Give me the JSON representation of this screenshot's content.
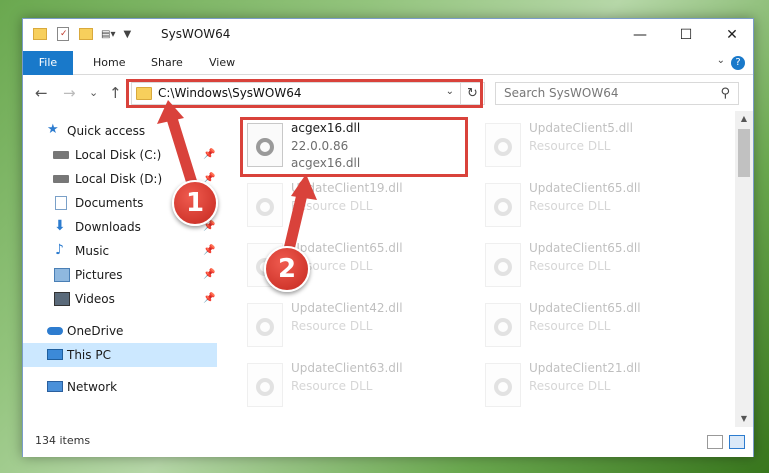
{
  "titlebar": {
    "title": "SysWOW64",
    "minimize": "—",
    "maximize": "☐",
    "close": "✕"
  },
  "ribbon": {
    "tabs": [
      {
        "label": "File"
      },
      {
        "label": "Home"
      },
      {
        "label": "Share"
      },
      {
        "label": "View"
      }
    ],
    "help": "?"
  },
  "nav": {
    "back": "←",
    "forward": "→",
    "recent": "⌄",
    "up": "↑",
    "address": "C:\\Windows\\SysWOW64",
    "refresh": "↻",
    "search_placeholder": "Search SysWOW64"
  },
  "sidebar": {
    "items": [
      {
        "label": "Quick access",
        "icon": "star-icon"
      },
      {
        "label": "Local Disk (C:)",
        "icon": "drive-icon",
        "pinned": true
      },
      {
        "label": "Local Disk (D:)",
        "icon": "drive-icon",
        "pinned": true
      },
      {
        "label": "Documents",
        "icon": "documents-icon",
        "pinned": true
      },
      {
        "label": "Downloads",
        "icon": "downloads-icon",
        "pinned": true
      },
      {
        "label": "Music",
        "icon": "music-icon",
        "pinned": true
      },
      {
        "label": "Pictures",
        "icon": "pictures-icon",
        "pinned": true
      },
      {
        "label": "Videos",
        "icon": "videos-icon",
        "pinned": true
      },
      {
        "label": "OneDrive",
        "icon": "onedrive-icon"
      },
      {
        "label": "This PC",
        "icon": "pc-icon",
        "selected": true
      },
      {
        "label": "Network",
        "icon": "network-icon"
      }
    ]
  },
  "files": [
    {
      "name": "acgex16.dll",
      "line2": "22.0.0.86",
      "line3": "acgex16.dll",
      "highlight": true
    },
    {
      "name": "UpdateClient5.dll",
      "line2": "Resource DLL"
    },
    {
      "name": "UpdateClient19.dll",
      "line2": "Resource DLL"
    },
    {
      "name": "UpdateClient65.dll",
      "line2": "Resource DLL"
    },
    {
      "name": "UpdateClient65.dll",
      "line2": "Resource DLL"
    },
    {
      "name": "UpdateClient65.dll",
      "line2": "Resource DLL"
    },
    {
      "name": "UpdateClient42.dll",
      "line2": "Resource DLL"
    },
    {
      "name": "UpdateClient65.dll",
      "line2": "Resource DLL"
    },
    {
      "name": "UpdateClient63.dll",
      "line2": "Resource DLL"
    },
    {
      "name": "UpdateClient21.dll",
      "line2": "Resource DLL"
    }
  ],
  "status": {
    "item_count": "134 items"
  },
  "annotations": [
    {
      "number": "1"
    },
    {
      "number": "2"
    }
  ],
  "colors": {
    "accent": "#1979ca",
    "highlight": "#d9423b",
    "selected_bg": "#cce8ff"
  }
}
